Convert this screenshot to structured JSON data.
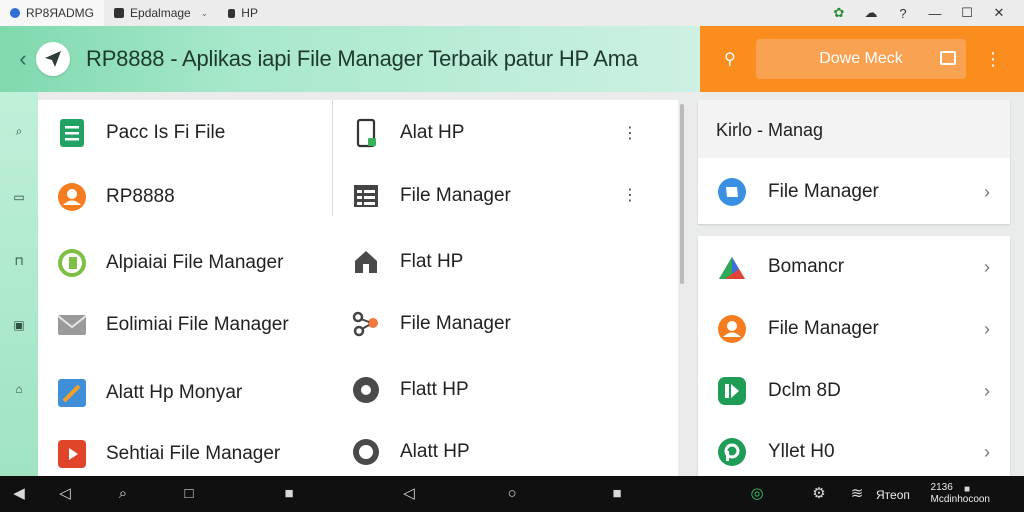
{
  "window": {
    "tabs": [
      {
        "label": "RP8ЯADMG",
        "icon": "app-icon"
      },
      {
        "label": "Epdalmage",
        "icon": "document-icon"
      },
      {
        "label": "HP",
        "icon": "lock-icon"
      }
    ],
    "controls": [
      "leaf-icon",
      "cloud-icon",
      "help-icon",
      "minimize-icon",
      "maximize-icon",
      "close-icon"
    ]
  },
  "header": {
    "title": "RP8888 - Aplikas iapi File Manager Terbaik patur HP Ama",
    "action_button": "Dowe Meck",
    "brand_color": "#7fd9ad",
    "accent_color": "#fb8c1e"
  },
  "list_left": [
    {
      "label": "Pacc Is Fi File",
      "icon": "document-green-icon"
    },
    {
      "label": "RP8888",
      "icon": "user-orange-icon"
    },
    {
      "label": "Alpiaiai File Manager",
      "icon": "refresh-green-icon"
    },
    {
      "label": "Eolimiai File Manager",
      "icon": "mail-icon"
    },
    {
      "label": "Alatt Hp Monyar",
      "icon": "pen-blue-icon"
    },
    {
      "label": "Sehtiai File Manager",
      "icon": "play-red-icon"
    }
  ],
  "list_right": [
    {
      "label": "Alat HP",
      "icon": "phone-icon"
    },
    {
      "label": "File Manager",
      "icon": "grid-list-icon"
    },
    {
      "label": "Flat HP",
      "icon": "home-icon"
    },
    {
      "label": "File Manager",
      "icon": "share-icon"
    },
    {
      "label": "Flatt HP",
      "icon": "gear-icon"
    },
    {
      "label": "Alatt HP",
      "icon": "circle-icon"
    }
  ],
  "side_panel": {
    "heading": "Kirlo - Manag",
    "top_item": {
      "label": "File Manager",
      "icon": "folder-blue-icon"
    },
    "items": [
      {
        "label": "Bomancr",
        "icon": "drive-icon"
      },
      {
        "label": "File Manager",
        "icon": "user-orange-icon"
      },
      {
        "label": "Dclm 8D",
        "icon": "app-green-icon"
      },
      {
        "label": "Yllet H0",
        "icon": "refresh-green-icon"
      }
    ]
  },
  "taskbar": {
    "status_text": "Ятеоп",
    "clock": {
      "time": "2136",
      "date": "Mcdinhocoon"
    }
  }
}
